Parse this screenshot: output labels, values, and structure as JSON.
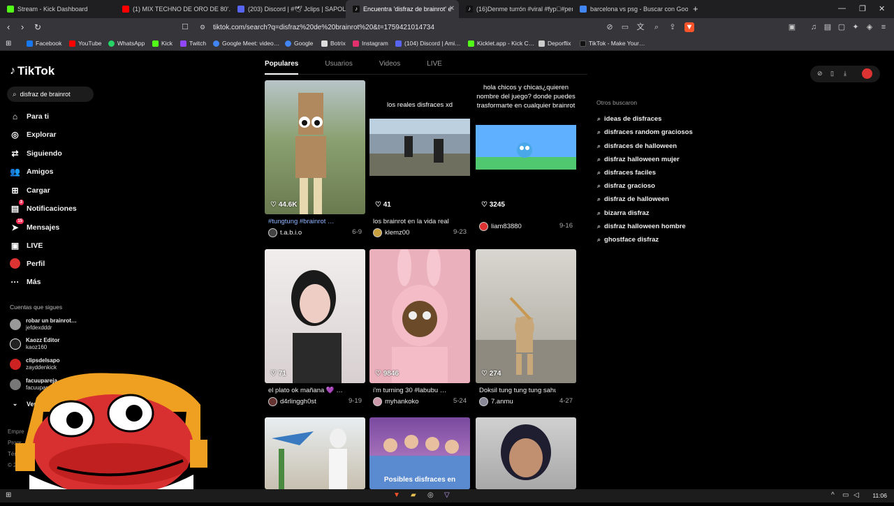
{
  "browser": {
    "tabs": [
      {
        "label": "Stream - Kick Dashboard",
        "color": "#53fc18",
        "active": false
      },
      {
        "label": "(1) MIX TECHNO DE ORO DE 80'…",
        "color": "#ff0000",
        "active": false
      },
      {
        "label": "(203) Discord | #🕊 Jclips | SAPOLIC",
        "color": "#5865f2",
        "active": false
      },
      {
        "label": "Encuentra 'disfraz de brainrot' e",
        "color": "#111111",
        "active": true
      },
      {
        "label": "(16)Denme turrón #viral #fyp゚#pen",
        "color": "#111111",
        "active": false
      },
      {
        "label": "barcelona vs psg - Buscar con Googl",
        "color": "#4285f4",
        "active": false
      }
    ],
    "url": "tiktok.com/search?q=disfraz%20de%20brainrot%20&t=1759421014734",
    "bookmarks": [
      {
        "label": "Facebook",
        "color": "#1877f2"
      },
      {
        "label": "YouTube",
        "color": "#ff0000"
      },
      {
        "label": "WhatsApp",
        "color": "#25d366"
      },
      {
        "label": "Kick",
        "color": "#53fc18"
      },
      {
        "label": "Twitch",
        "color": "#9146ff"
      },
      {
        "label": "Google Meet: video…",
        "color": "#00897b"
      },
      {
        "label": "Google",
        "color": "#4285f4"
      },
      {
        "label": "Botrix",
        "color": "#dddddd"
      },
      {
        "label": "Instagram",
        "color": "#e1306c"
      },
      {
        "label": "(104) Discord | Ami…",
        "color": "#5865f2"
      },
      {
        "label": "Kicklet.app - Kick C…",
        "color": "#53fc18"
      },
      {
        "label": "Deporflix",
        "color": "#cccccc"
      },
      {
        "label": "TikTok - Make Your…",
        "color": "#111111"
      }
    ]
  },
  "tiktok": {
    "logo": "TikTok",
    "search_value": "disfraz de brainrot",
    "nav": [
      {
        "label": "Para ti",
        "icon": "home-icon"
      },
      {
        "label": "Explorar",
        "icon": "compass-icon"
      },
      {
        "label": "Siguiendo",
        "icon": "following-icon"
      },
      {
        "label": "Amigos",
        "icon": "friends-icon"
      },
      {
        "label": "Cargar",
        "icon": "upload-icon"
      },
      {
        "label": "Notificaciones",
        "icon": "inbox-icon",
        "badge": "3"
      },
      {
        "label": "Mensajes",
        "icon": "messages-icon",
        "badge": "15"
      },
      {
        "label": "LIVE",
        "icon": "live-icon"
      },
      {
        "label": "Perfil",
        "icon": "profile-icon"
      },
      {
        "label": "Más",
        "icon": "more-icon"
      }
    ],
    "following_title": "Cuentas que sigues",
    "accounts": [
      {
        "name": "robar un brainrot…",
        "handle": "jefdexdddr",
        "color": "#999999"
      },
      {
        "name": "Kaozz Editor",
        "handle": "kaoz160",
        "color": "#222222"
      },
      {
        "name": "clipsdelsapo",
        "handle": "zayddenkick",
        "color": "#cc2222"
      },
      {
        "name": "facuupareja…",
        "handle": "facuupareja…",
        "color": "#777777"
      }
    ],
    "see_more": "Ver",
    "footer": [
      "Empre",
      "Progr",
      "Térm",
      "© 20"
    ],
    "content_tabs": [
      "Populares",
      "Usuarios",
      "Videos",
      "LIVE"
    ],
    "videos": [
      {
        "likes": "44.6K",
        "caption": "#tungtung #brainrot …",
        "user": "t.a.b.i.o",
        "date": "6-9",
        "overlay": "",
        "bg": "#8a8a7a"
      },
      {
        "likes": "41",
        "caption": "los brainrot en la vida real …",
        "user": "klemz00",
        "date": "9-23",
        "overlay": "los reales disfraces xd",
        "bg": "#000000"
      },
      {
        "likes": "3245",
        "caption": "",
        "user": "liam83880",
        "date": "9-16",
        "overlay": "hola chicos y chicas¿quieren nombre del juego? donde puedes trasformarte en cualquier brainrot",
        "bg": "#000000"
      },
      {
        "likes": "71",
        "caption": "el plato ok mañana 💜 …",
        "user": "d4rlinggh0st",
        "date": "9-19",
        "overlay": "",
        "bg": "#e8e4e4"
      },
      {
        "likes": "9846",
        "caption": "i'm turning 30 #labubu …",
        "user": "myhankoko",
        "date": "5-24",
        "overlay": "",
        "bg": "#e6a7b2"
      },
      {
        "likes": "274",
        "caption": "Doksil tung tung tung sahur …",
        "user": "7.anmu",
        "date": "4-27",
        "overlay": "",
        "bg": "#c9c7c0"
      },
      {
        "likes": "",
        "caption": "",
        "user": "",
        "date": "",
        "overlay": "",
        "bg": "#8fb8d8"
      },
      {
        "likes": "",
        "caption": "",
        "user": "",
        "date": "",
        "overlay": "Posibles disfraces en",
        "bg": "#8a5aa8"
      },
      {
        "likes": "",
        "caption": "",
        "user": "",
        "date": "",
        "overlay": "",
        "bg": "#bdbdbd"
      }
    ],
    "related_title": "Otros buscaron",
    "related": [
      "ideas de disfraces",
      "disfraces random graciosos",
      "disfraces de halloween",
      "disfraz halloween mujer",
      "disfraces faciles",
      "disfraz gracioso",
      "disfraz de halloween",
      "bizarra disfraz",
      "disfraz halloween hombre",
      "ghostface disfraz"
    ]
  },
  "system": {
    "clock": "11:06"
  }
}
